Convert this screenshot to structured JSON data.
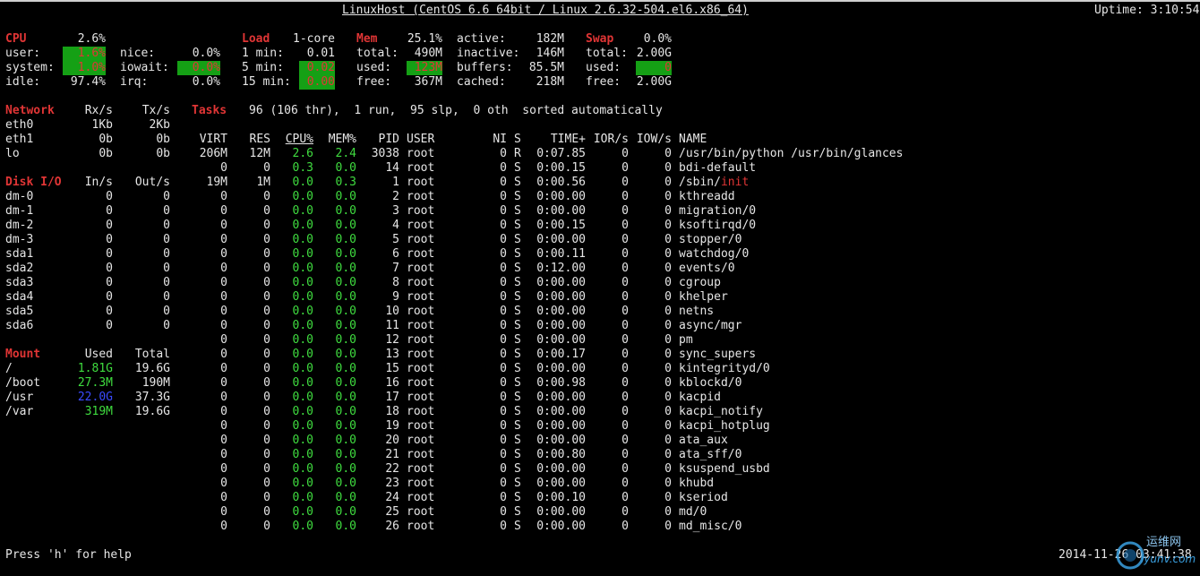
{
  "header": {
    "title": "LinuxHost (CentOS 6.6 64bit / Linux 2.6.32-504.el6.x86_64)",
    "uptime": "Uptime: 3:10:54"
  },
  "cpu": {
    "label": "CPU",
    "total": "2.6%",
    "user_l": "user:",
    "user_v": "1.6%",
    "system_l": "system:",
    "system_v": "1.0%",
    "idle_l": "idle:",
    "idle_v": "97.4%",
    "nice_l": "nice:",
    "nice_v": "0.0%",
    "iowait_l": "iowait:",
    "iowait_v": "0.0%",
    "irq_l": "irq:",
    "irq_v": "0.0%"
  },
  "load": {
    "label": "Load",
    "cores": "1-core",
    "m1_l": "1 min:",
    "m1_v": "0.01",
    "m5_l": "5 min:",
    "m5_v": "0.02",
    "m15_l": "15 min:",
    "m15_v": "0.00"
  },
  "mem": {
    "label": "Mem",
    "pct": "25.1%",
    "total_l": "total:",
    "total_v": "490M",
    "used_l": "used:",
    "used_v": "123M",
    "free_l": "free:",
    "free_v": "367M",
    "active_l": "active:",
    "active_v": "182M",
    "inactive_l": "inactive:",
    "inactive_v": "146M",
    "buffers_l": "buffers:",
    "buffers_v": "85.5M",
    "cached_l": "cached:",
    "cached_v": "218M"
  },
  "swap": {
    "label": "Swap",
    "pct": "0.0%",
    "total_l": "total:",
    "total_v": "2.00G",
    "used_l": "used:",
    "used_v": "0",
    "free_l": "free:",
    "free_v": "2.00G"
  },
  "network": {
    "label": "Network",
    "rx_h": "Rx/s",
    "tx_h": "Tx/s",
    "rows": [
      {
        "name": "eth0",
        "rx": "1Kb",
        "tx": "2Kb"
      },
      {
        "name": "eth1",
        "rx": "0b",
        "tx": "0b"
      },
      {
        "name": "lo",
        "rx": "0b",
        "tx": "0b"
      }
    ]
  },
  "tasks": {
    "label": "Tasks",
    "summary": "96 (106 thr),  1 run,  95 slp,  0 oth  sorted automatically"
  },
  "diskio": {
    "label": "Disk I/O",
    "in_h": "In/s",
    "out_h": "Out/s",
    "rows": [
      {
        "name": "dm-0",
        "in": "0",
        "out": "0"
      },
      {
        "name": "dm-1",
        "in": "0",
        "out": "0"
      },
      {
        "name": "dm-2",
        "in": "0",
        "out": "0"
      },
      {
        "name": "dm-3",
        "in": "0",
        "out": "0"
      },
      {
        "name": "sda1",
        "in": "0",
        "out": "0"
      },
      {
        "name": "sda2",
        "in": "0",
        "out": "0"
      },
      {
        "name": "sda3",
        "in": "0",
        "out": "0"
      },
      {
        "name": "sda4",
        "in": "0",
        "out": "0"
      },
      {
        "name": "sda5",
        "in": "0",
        "out": "0"
      },
      {
        "name": "sda6",
        "in": "0",
        "out": "0"
      }
    ]
  },
  "mount": {
    "label": "Mount",
    "used_h": "Used",
    "total_h": "Total",
    "rows": [
      {
        "name": "/",
        "used": "1.81G",
        "total": "19.6G",
        "color": "#3fdc3f"
      },
      {
        "name": "/boot",
        "used": "27.3M",
        "total": "190M",
        "color": "#3fdc3f"
      },
      {
        "name": "/usr",
        "used": "22.0G",
        "total": "37.3G",
        "color": "#3a4bff"
      },
      {
        "name": "/var",
        "used": "319M",
        "total": "19.6G",
        "color": "#3fdc3f"
      }
    ]
  },
  "proc_headers": {
    "virt": "VIRT",
    "res": "RES",
    "cpu": "CPU%",
    "mem": "MEM%",
    "pid": "PID",
    "user": "USER",
    "ni": "NI",
    "s": "S",
    "time": "TIME+",
    "ior": "IOR/s",
    "iow": "IOW/s",
    "name": "NAME"
  },
  "processes": [
    {
      "virt": "206M",
      "res": "12M",
      "cpu": "2.6",
      "mem": "2.4",
      "pid": "3038",
      "user": "root",
      "ni": "0",
      "s": "R",
      "time": "0:07.85",
      "ior": "0",
      "iow": "0",
      "name": "/usr/bin/python /usr/bin/glances"
    },
    {
      "virt": "0",
      "res": "0",
      "cpu": "0.3",
      "mem": "0.0",
      "pid": "14",
      "user": "root",
      "ni": "0",
      "s": "S",
      "time": "0:00.15",
      "ior": "0",
      "iow": "0",
      "name": "bdi-default"
    },
    {
      "virt": "19M",
      "res": "1M",
      "cpu": "0.0",
      "mem": "0.3",
      "pid": "1",
      "user": "root",
      "ni": "0",
      "s": "S",
      "time": "0:00.56",
      "ior": "0",
      "iow": "0",
      "name": "/sbin/",
      "name_hl": "init"
    },
    {
      "virt": "0",
      "res": "0",
      "cpu": "0.0",
      "mem": "0.0",
      "pid": "2",
      "user": "root",
      "ni": "0",
      "s": "S",
      "time": "0:00.00",
      "ior": "0",
      "iow": "0",
      "name": "kthreadd"
    },
    {
      "virt": "0",
      "res": "0",
      "cpu": "0.0",
      "mem": "0.0",
      "pid": "3",
      "user": "root",
      "ni": "0",
      "s": "S",
      "time": "0:00.00",
      "ior": "0",
      "iow": "0",
      "name": "migration/0"
    },
    {
      "virt": "0",
      "res": "0",
      "cpu": "0.0",
      "mem": "0.0",
      "pid": "4",
      "user": "root",
      "ni": "0",
      "s": "S",
      "time": "0:00.15",
      "ior": "0",
      "iow": "0",
      "name": "ksoftirqd/0"
    },
    {
      "virt": "0",
      "res": "0",
      "cpu": "0.0",
      "mem": "0.0",
      "pid": "5",
      "user": "root",
      "ni": "0",
      "s": "S",
      "time": "0:00.00",
      "ior": "0",
      "iow": "0",
      "name": "stopper/0"
    },
    {
      "virt": "0",
      "res": "0",
      "cpu": "0.0",
      "mem": "0.0",
      "pid": "6",
      "user": "root",
      "ni": "0",
      "s": "S",
      "time": "0:00.11",
      "ior": "0",
      "iow": "0",
      "name": "watchdog/0"
    },
    {
      "virt": "0",
      "res": "0",
      "cpu": "0.0",
      "mem": "0.0",
      "pid": "7",
      "user": "root",
      "ni": "0",
      "s": "S",
      "time": "0:12.00",
      "ior": "0",
      "iow": "0",
      "name": "events/0"
    },
    {
      "virt": "0",
      "res": "0",
      "cpu": "0.0",
      "mem": "0.0",
      "pid": "8",
      "user": "root",
      "ni": "0",
      "s": "S",
      "time": "0:00.00",
      "ior": "0",
      "iow": "0",
      "name": "cgroup"
    },
    {
      "virt": "0",
      "res": "0",
      "cpu": "0.0",
      "mem": "0.0",
      "pid": "9",
      "user": "root",
      "ni": "0",
      "s": "S",
      "time": "0:00.00",
      "ior": "0",
      "iow": "0",
      "name": "khelper"
    },
    {
      "virt": "0",
      "res": "0",
      "cpu": "0.0",
      "mem": "0.0",
      "pid": "10",
      "user": "root",
      "ni": "0",
      "s": "S",
      "time": "0:00.00",
      "ior": "0",
      "iow": "0",
      "name": "netns"
    },
    {
      "virt": "0",
      "res": "0",
      "cpu": "0.0",
      "mem": "0.0",
      "pid": "11",
      "user": "root",
      "ni": "0",
      "s": "S",
      "time": "0:00.00",
      "ior": "0",
      "iow": "0",
      "name": "async/mgr"
    },
    {
      "virt": "0",
      "res": "0",
      "cpu": "0.0",
      "mem": "0.0",
      "pid": "12",
      "user": "root",
      "ni": "0",
      "s": "S",
      "time": "0:00.00",
      "ior": "0",
      "iow": "0",
      "name": "pm"
    },
    {
      "virt": "0",
      "res": "0",
      "cpu": "0.0",
      "mem": "0.0",
      "pid": "13",
      "user": "root",
      "ni": "0",
      "s": "S",
      "time": "0:00.17",
      "ior": "0",
      "iow": "0",
      "name": "sync_supers"
    },
    {
      "virt": "0",
      "res": "0",
      "cpu": "0.0",
      "mem": "0.0",
      "pid": "15",
      "user": "root",
      "ni": "0",
      "s": "S",
      "time": "0:00.00",
      "ior": "0",
      "iow": "0",
      "name": "kintegrityd/0"
    },
    {
      "virt": "0",
      "res": "0",
      "cpu": "0.0",
      "mem": "0.0",
      "pid": "16",
      "user": "root",
      "ni": "0",
      "s": "S",
      "time": "0:00.98",
      "ior": "0",
      "iow": "0",
      "name": "kblockd/0"
    },
    {
      "virt": "0",
      "res": "0",
      "cpu": "0.0",
      "mem": "0.0",
      "pid": "17",
      "user": "root",
      "ni": "0",
      "s": "S",
      "time": "0:00.00",
      "ior": "0",
      "iow": "0",
      "name": "kacpid"
    },
    {
      "virt": "0",
      "res": "0",
      "cpu": "0.0",
      "mem": "0.0",
      "pid": "18",
      "user": "root",
      "ni": "0",
      "s": "S",
      "time": "0:00.00",
      "ior": "0",
      "iow": "0",
      "name": "kacpi_notify"
    },
    {
      "virt": "0",
      "res": "0",
      "cpu": "0.0",
      "mem": "0.0",
      "pid": "19",
      "user": "root",
      "ni": "0",
      "s": "S",
      "time": "0:00.00",
      "ior": "0",
      "iow": "0",
      "name": "kacpi_hotplug"
    },
    {
      "virt": "0",
      "res": "0",
      "cpu": "0.0",
      "mem": "0.0",
      "pid": "20",
      "user": "root",
      "ni": "0",
      "s": "S",
      "time": "0:00.00",
      "ior": "0",
      "iow": "0",
      "name": "ata_aux"
    },
    {
      "virt": "0",
      "res": "0",
      "cpu": "0.0",
      "mem": "0.0",
      "pid": "21",
      "user": "root",
      "ni": "0",
      "s": "S",
      "time": "0:00.80",
      "ior": "0",
      "iow": "0",
      "name": "ata_sff/0"
    },
    {
      "virt": "0",
      "res": "0",
      "cpu": "0.0",
      "mem": "0.0",
      "pid": "22",
      "user": "root",
      "ni": "0",
      "s": "S",
      "time": "0:00.00",
      "ior": "0",
      "iow": "0",
      "name": "ksuspend_usbd"
    },
    {
      "virt": "0",
      "res": "0",
      "cpu": "0.0",
      "mem": "0.0",
      "pid": "23",
      "user": "root",
      "ni": "0",
      "s": "S",
      "time": "0:00.00",
      "ior": "0",
      "iow": "0",
      "name": "khubd"
    },
    {
      "virt": "0",
      "res": "0",
      "cpu": "0.0",
      "mem": "0.0",
      "pid": "24",
      "user": "root",
      "ni": "0",
      "s": "S",
      "time": "0:00.10",
      "ior": "0",
      "iow": "0",
      "name": "kseriod"
    },
    {
      "virt": "0",
      "res": "0",
      "cpu": "0.0",
      "mem": "0.0",
      "pid": "25",
      "user": "root",
      "ni": "0",
      "s": "S",
      "time": "0:00.00",
      "ior": "0",
      "iow": "0",
      "name": "md/0"
    },
    {
      "virt": "0",
      "res": "0",
      "cpu": "0.0",
      "mem": "0.0",
      "pid": "26",
      "user": "root",
      "ni": "0",
      "s": "S",
      "time": "0:00.00",
      "ior": "0",
      "iow": "0",
      "name": "md_misc/0"
    }
  ],
  "footer": {
    "help": "Press 'h' for help",
    "datetime": "2014-11-26 03:41:38"
  },
  "watermark": {
    "text1": "运维网",
    "text2": "iyunv.com"
  }
}
